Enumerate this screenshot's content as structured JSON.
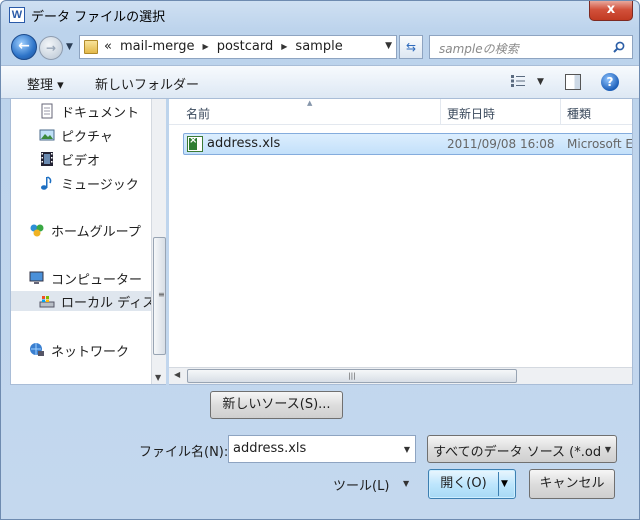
{
  "window": {
    "title": "データ ファイルの選択",
    "app_icon_letter": "W",
    "close_symbol": "x"
  },
  "nav": {
    "back_symbol": "←",
    "forward_symbol": "→",
    "breadcrumb_prefix": "«",
    "breadcrumbs": [
      "mail-merge",
      "postcard",
      "sample"
    ],
    "search_placeholder": "sampleの検索"
  },
  "toolbar": {
    "organize_label": "整理 ▾",
    "new_folder_label": "新しいフォルダー",
    "help_symbol": "?"
  },
  "sidebar": {
    "items": [
      {
        "label": "ドキュメント",
        "icon": "document-icon"
      },
      {
        "label": "ピクチャ",
        "icon": "picture-icon"
      },
      {
        "label": "ビデオ",
        "icon": "video-icon"
      },
      {
        "label": "ミュージック",
        "icon": "music-icon"
      },
      {
        "label": "ホームグループ",
        "icon": "homegroup-icon"
      },
      {
        "label": "コンピューター",
        "icon": "computer-icon"
      },
      {
        "label": "ローカル ディスク",
        "icon": "local-disk-icon",
        "selected": true
      },
      {
        "label": "ネットワーク",
        "icon": "network-icon"
      }
    ]
  },
  "filelist": {
    "columns": [
      "名前",
      "更新日時",
      "種類"
    ],
    "rows": [
      {
        "name": "address.xls",
        "modified": "2011/09/08 16:08",
        "type": "Microsoft Ex",
        "selected": true
      }
    ]
  },
  "footer": {
    "new_source_label": "新しいソース(S)...",
    "filename_label": "ファイル名(N):",
    "filename_value": "address.xls",
    "filter_value": "すべてのデータ ソース (*.odc",
    "tools_label": "ツール(L)",
    "open_label": "開く(O)",
    "cancel_label": "キャンセル"
  },
  "colors": {
    "selection_bg": "#c3e0fa",
    "selection_border": "#84acdd",
    "close_red": "#c13a22",
    "chrome_blue": "#bcd3ec"
  }
}
